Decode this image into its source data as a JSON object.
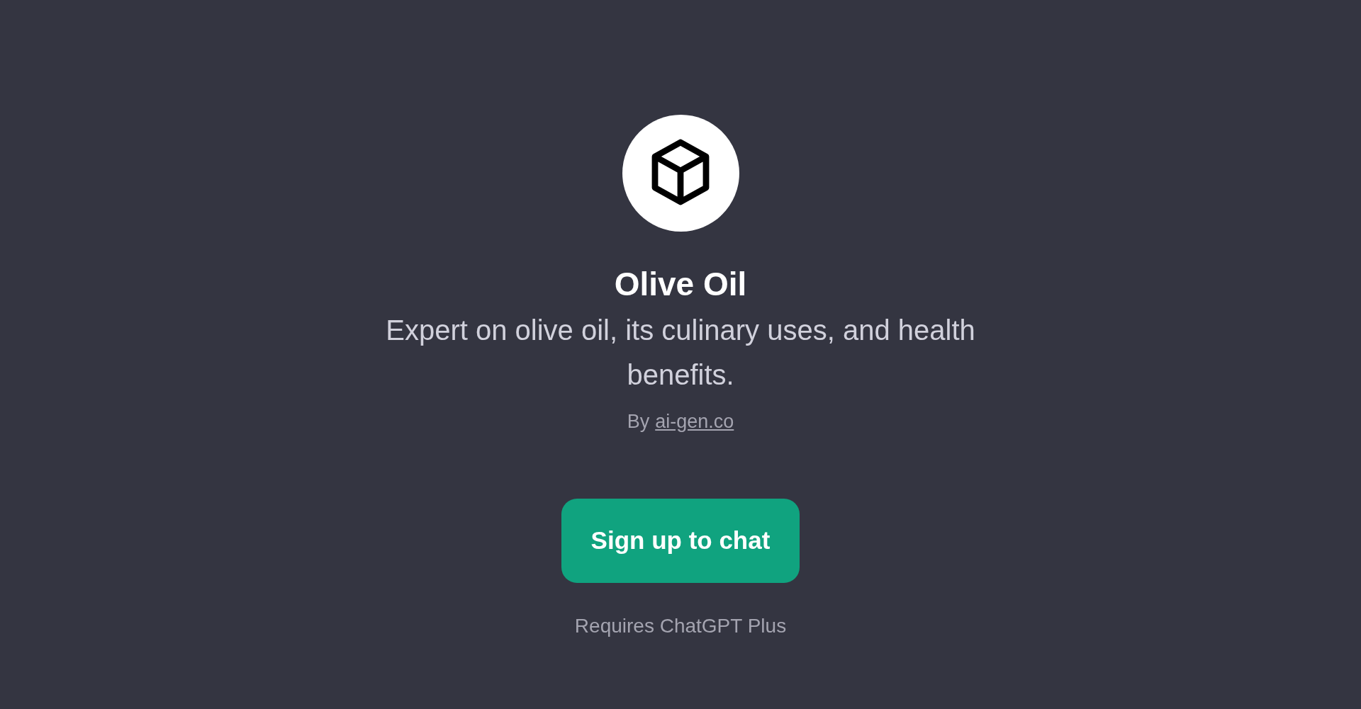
{
  "gpt": {
    "name": "Olive Oil",
    "description": "Expert on olive oil, its culinary uses, and health benefits.",
    "by_prefix": "By",
    "author_link": "ai-gen.co"
  },
  "button": {
    "label": "Sign up to chat"
  },
  "note": "Requires ChatGPT Plus"
}
